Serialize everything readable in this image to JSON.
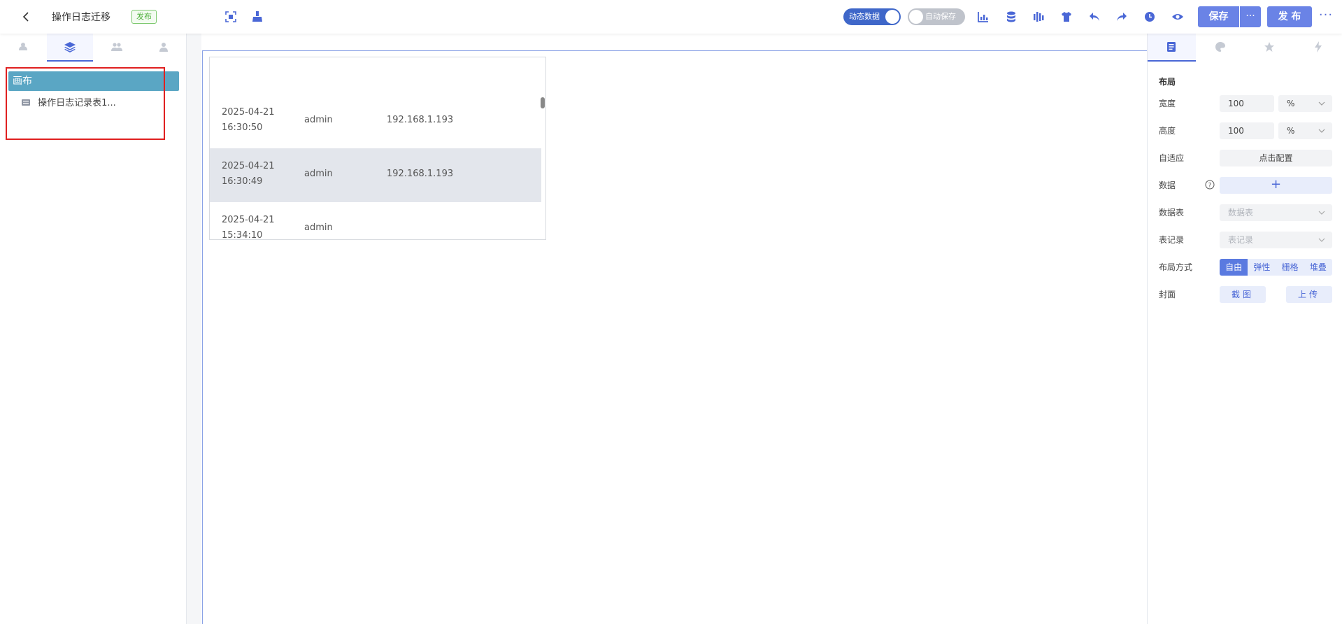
{
  "header": {
    "title": "操作日志迁移",
    "badge": "发布",
    "toggle_dynamic": "动态数据",
    "toggle_autosave": "自动保存",
    "save_label": "保存",
    "save_more_label": "···",
    "publish_label": "发 布",
    "more_label": "···"
  },
  "left_panel": {
    "tree": {
      "root_label": "画布",
      "child_label": "操作日志记录表1..."
    }
  },
  "table_widget": {
    "rows": [
      {
        "time_date": "2025-04-21",
        "time_clock": "16:30:50",
        "user": "admin",
        "ip": "192.168.1.193"
      },
      {
        "time_date": "2025-04-21",
        "time_clock": "16:30:49",
        "user": "admin",
        "ip": "192.168.1.193"
      },
      {
        "time_date": "2025-04-21",
        "time_clock": "15:34:10",
        "user": "admin",
        "ip": ""
      }
    ]
  },
  "right_panel": {
    "section_title": "布局",
    "width_label": "宽度",
    "width_value": "100",
    "width_unit": "%",
    "height_label": "高度",
    "height_value": "100",
    "height_unit": "%",
    "adaptive_label": "自适应",
    "adaptive_button": "点击配置",
    "data_label": "数据",
    "data_add": "+",
    "table_label": "数据表",
    "table_placeholder": "数据表",
    "record_label": "表记录",
    "record_placeholder": "表记录",
    "layout_mode_label": "布局方式",
    "layout_modes": [
      "自由",
      "弹性",
      "栅格",
      "堆叠"
    ],
    "cover_label": "封面",
    "cover_capture": "截图",
    "cover_upload": "上传"
  },
  "colors": {
    "accent": "#4a67d6",
    "primary_button": "#6a83e6",
    "tree_selected": "#5aa6c4",
    "highlight_box": "#e02020",
    "badge_green": "#52b240"
  },
  "icons": {
    "top_left": [
      "back-arrow-icon",
      "fit-screen-icon",
      "brush-icon"
    ],
    "top_right": [
      "chart-icon",
      "database-icon",
      "sound-bars-icon",
      "shirt-icon",
      "undo-icon",
      "redo-icon",
      "clock-icon",
      "eye-icon"
    ],
    "left_tabs": [
      "components-icon",
      "layers-icon",
      "group-icon",
      "user-icon"
    ],
    "right_tabs": [
      "properties-icon",
      "palette-icon",
      "star-icon",
      "lightning-icon"
    ]
  }
}
